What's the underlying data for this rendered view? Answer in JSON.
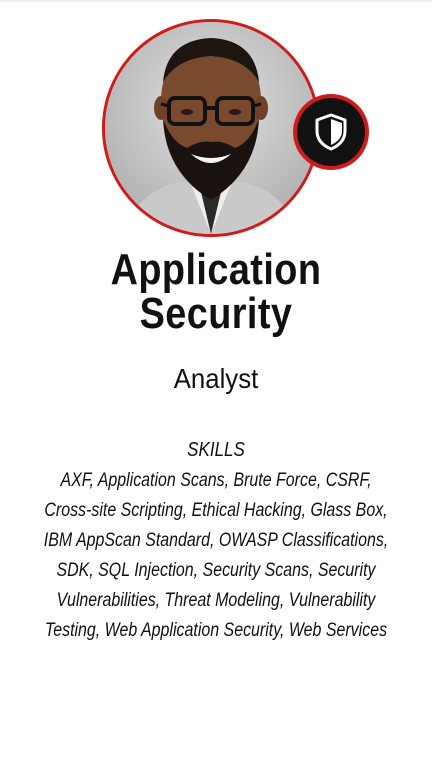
{
  "profile": {
    "title_line1": "Application",
    "title_line2": "Security",
    "subtitle": "Analyst",
    "badge_icon": "shield-icon",
    "colors": {
      "accent": "#d11a1a",
      "badge_bg": "#111111",
      "text": "#111111"
    }
  },
  "skills": {
    "heading": "SKILLS",
    "lines": [
      "AXF, Application Scans, Brute Force, CSRF,",
      "Cross-site Scripting, Ethical Hacking, Glass Box,",
      "IBM AppScan Standard, OWASP Classifications,",
      "SDK, SQL Injection, Security Scans, Security",
      "Vulnerabilities, Threat Modeling, Vulnerability",
      "Testing, Web Application Security, Web Services"
    ]
  }
}
